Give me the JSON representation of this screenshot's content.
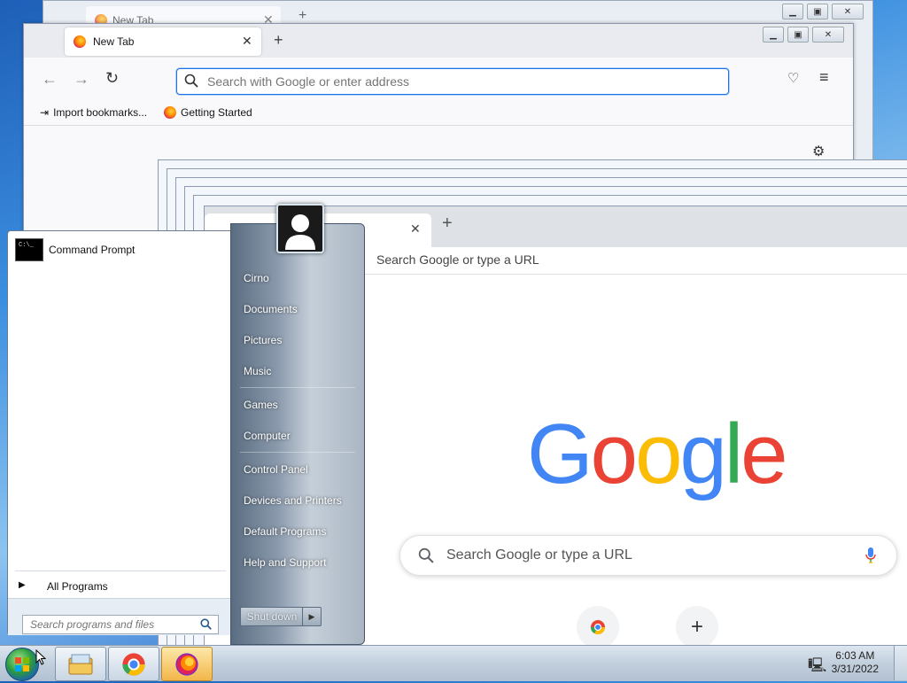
{
  "firefox_back": {
    "tab_label": "New Tab"
  },
  "firefox": {
    "tab_label": "New Tab",
    "url_placeholder": "Search with Google or enter address",
    "bookmarks": [
      "Import bookmarks...",
      "Getting Started"
    ]
  },
  "chrome": {
    "omnibox_placeholder": "Search Google or type a URL",
    "logo_text": [
      "G",
      "o",
      "o",
      "g",
      "l",
      "e"
    ],
    "logo_colors": [
      "#4285F4",
      "#EA4335",
      "#FBBC05",
      "#4285F4",
      "#34A853",
      "#EA4335"
    ],
    "search_placeholder": "Search Google or type a URL"
  },
  "start_menu": {
    "pinned": [
      {
        "label": "Command Prompt",
        "icon": "cmd-icon"
      }
    ],
    "all_programs": "All Programs",
    "search_placeholder": "Search programs and files",
    "right_items": [
      "Cirno",
      "Documents",
      "Pictures",
      "Music",
      "Games",
      "Computer",
      "Control Panel",
      "Devices and Printers",
      "Default Programs",
      "Help and Support"
    ],
    "shutdown_label": "Shut down"
  },
  "taskbar": {
    "apps": [
      "explorer-icon",
      "chrome-icon",
      "firefox-icon"
    ],
    "time": "6:03 AM",
    "date": "3/31/2022"
  },
  "colors": {
    "accent": "#1a73e8",
    "firefox_orange": "#ff8a00"
  }
}
